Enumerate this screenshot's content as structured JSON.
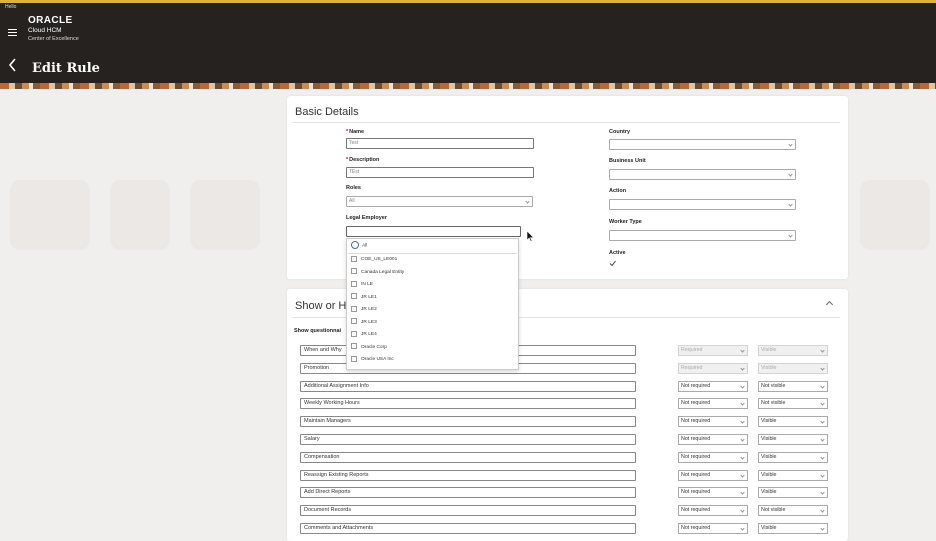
{
  "header": {
    "hello": "Hello",
    "brand_logo": "ORACLE",
    "brand_line1": "Cloud HCM",
    "brand_line2": "Center of Excellence",
    "page_title": "Edit Rule"
  },
  "basic_details": {
    "title": "Basic Details",
    "name_label": "Name",
    "name_value": "Test",
    "description_label": "Description",
    "description_value": "TEst",
    "roles_label": "Roles",
    "roles_value": "All",
    "legal_employer_label": "Legal Employer",
    "country_label": "Country",
    "business_unit_label": "Business Unit",
    "action_label": "Action",
    "worker_type_label": "Worker Type",
    "active_label": "Active"
  },
  "legal_employer_dropdown": {
    "all_label": "All",
    "options": [
      "COE_US_LE001",
      "Canada Legal Entity",
      "IN LE",
      "JR LE1",
      "JR LE2",
      "JR LE3",
      "JR LE4",
      "Oracle Corp",
      "Oracle USA Inc"
    ]
  },
  "show_hide": {
    "title_visible": "Show or H",
    "description_visible": "Show questionnai",
    "rows": [
      {
        "name": "When and Why",
        "required": "Required",
        "visible": "Visible",
        "disabled": true
      },
      {
        "name": "Promotion",
        "required": "Required",
        "visible": "Visible",
        "disabled": true
      },
      {
        "name": "Additional Assignment Info",
        "required": "Not required",
        "visible": "Not visible",
        "disabled": false
      },
      {
        "name": "Weekly Working Hours",
        "required": "Not required",
        "visible": "Not visible",
        "disabled": false
      },
      {
        "name": "Maintain Managers",
        "required": "Not required",
        "visible": "Visible",
        "disabled": false
      },
      {
        "name": "Salary",
        "required": "Not required",
        "visible": "Visible",
        "disabled": false
      },
      {
        "name": "Compensation",
        "required": "Not required",
        "visible": "Visible",
        "disabled": false
      },
      {
        "name": "Reassign Existing Reports",
        "required": "Not required",
        "visible": "Visible",
        "disabled": false
      },
      {
        "name": "Add Direct Reports",
        "required": "Not required",
        "visible": "Visible",
        "disabled": false
      },
      {
        "name": "Document Records",
        "required": "Not required",
        "visible": "Not visible",
        "disabled": false
      },
      {
        "name": "Comments and Attachments",
        "required": "Not required",
        "visible": "Visible",
        "disabled": false
      }
    ]
  }
}
